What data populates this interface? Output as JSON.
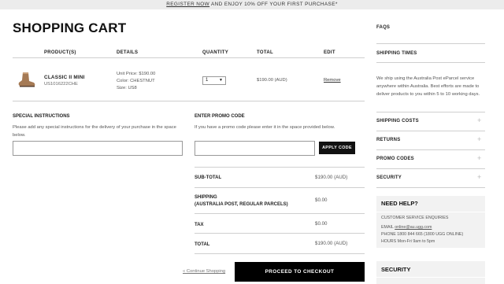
{
  "promo_bar": {
    "link": "REGISTER NOW",
    "text": "AND ENJOY 10% OFF YOUR FIRST PURCHASE*"
  },
  "cart": {
    "title": "SHOPPING CART",
    "columns": [
      "PRODUCT(S)",
      "DETAILS",
      "QUANTITY",
      "TOTAL",
      "EDIT"
    ],
    "item": {
      "name": "CLASSIC II MINI",
      "sku": "US1016222CHE",
      "unit_price": "Unit Price: $190.00",
      "color": "Color: CHESTNUT",
      "size": "Size: US8",
      "quantity": "1",
      "total": "$190.00 (AUD)",
      "remove": "Remove",
      "thumb_color": "#a57a55"
    }
  },
  "special_instructions": {
    "title": "SPECIAL INSTRUCTIONS",
    "text": "Please add any special instructions for the delivery of your purchase in the space below."
  },
  "promo_code": {
    "title": "ENTER PROMO CODE",
    "text": "If you have a promo code please enter it in the space provided below.",
    "button": "APPLY CODE"
  },
  "summary": {
    "subtotal_label": "SUB-TOTAL",
    "subtotal_value": "$190.00 (AUD)",
    "shipping_label": "SHIPPING",
    "shipping_sub": "(AUSTRALIA POST, REGULAR PARCELS)",
    "shipping_value": "$0.00",
    "tax_label": "TAX",
    "tax_value": "$0.00",
    "total_label": "TOTAL",
    "total_value": "$190.00 (AUD)"
  },
  "actions": {
    "continue": "« Continue Shopping",
    "checkout": "PROCEED TO CHECKOUT"
  },
  "sidebar": {
    "faqs": "FAQS",
    "shipping_times": {
      "title": "SHIPPING TIMES",
      "text": "We ship using the Australia Post eParcel service anywhere within Australia. Best efforts are made to deliver products to you within 5 to 10 working days."
    },
    "items": [
      "SHIPPING COSTS",
      "RETURNS",
      "PROMO CODES",
      "SECURITY"
    ],
    "help": {
      "title": "NEED HELP?",
      "heading": "CUSTOMER SERVICE ENQUIRIES",
      "email_label": "EMAIL",
      "email": "online@au.ugg.com",
      "phone": "PHONE 1800 844 665 (1800 UGG ONLINE)",
      "hours": "HOURS Mon-Fri 9am to 5pm"
    },
    "security_title": "SECURITY"
  }
}
